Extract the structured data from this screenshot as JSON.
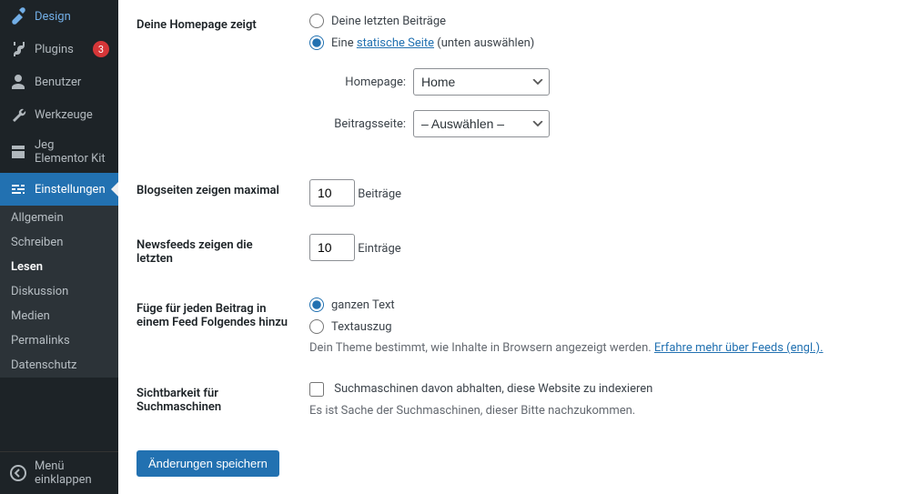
{
  "sidebar": {
    "items": [
      {
        "label": "Design"
      },
      {
        "label": "Plugins",
        "badge": "3"
      },
      {
        "label": "Benutzer"
      },
      {
        "label": "Werkzeuge"
      },
      {
        "label": "Jeg Elementor Kit"
      },
      {
        "label": "Einstellungen"
      }
    ],
    "sub": {
      "allgemein": "Allgemein",
      "schreiben": "Schreiben",
      "lesen": "Lesen",
      "diskussion": "Diskussion",
      "medien": "Medien",
      "permalinks": "Permalinks",
      "datenschutz": "Datenschutz"
    },
    "collapse": "Menü einklappen"
  },
  "form": {
    "homepage_label": "Deine Homepage zeigt",
    "opt_latest": "Deine letzten Beiträge",
    "opt_static_pre": "Eine ",
    "opt_static_link": "statische Seite",
    "opt_static_post": " (unten auswählen)",
    "homepage_select_label": "Homepage:",
    "homepage_value": "Home",
    "postspage_select_label": "Beitragsseite:",
    "postspage_value": "– Auswählen –",
    "blog_max_label": "Blogseiten zeigen maximal",
    "blog_max_value": "10",
    "blog_max_suffix": "Beiträge",
    "newsfeed_label": "Newsfeeds zeigen die letzten",
    "newsfeed_value": "10",
    "newsfeed_suffix": "Einträge",
    "feed_add_label": "Füge für jeden Beitrag in einem Feed Folgendes hinzu",
    "feed_full": "ganzen Text",
    "feed_excerpt": "Textauszug",
    "feed_desc_pre": "Dein Theme bestimmt, wie Inhalte in Browsern angezeigt werden. ",
    "feed_desc_link": "Erfahre mehr über Feeds (engl.).",
    "visibility_label": "Sichtbarkeit für Suchmaschinen",
    "visibility_check": "Suchmaschinen davon abhalten, diese Website zu indexieren",
    "visibility_desc": "Es ist Sache der Suchmaschinen, dieser Bitte nachzukommen.",
    "save": "Änderungen speichern"
  }
}
